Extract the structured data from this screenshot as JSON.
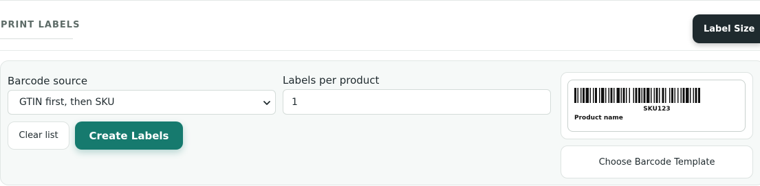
{
  "header": {
    "title": "PRINT LABELS",
    "label_size_button": "Label Size"
  },
  "form": {
    "barcode_source": {
      "label": "Barcode source",
      "selected": "GTIN first, then SKU"
    },
    "labels_per_product": {
      "label": "Labels per product",
      "value": "1"
    },
    "clear_button": "Clear list",
    "create_button": "Create Labels"
  },
  "preview": {
    "sku": "SKU123",
    "product_name": "Product name",
    "template_button": "Choose Barcode Template"
  },
  "colors": {
    "primary": "#167a6e",
    "dark": "#1f2a2e",
    "panel_bg": "#f6f9f8"
  },
  "icons": {
    "select_chevron": "chevron-down-icon",
    "barcode": "barcode-icon"
  }
}
